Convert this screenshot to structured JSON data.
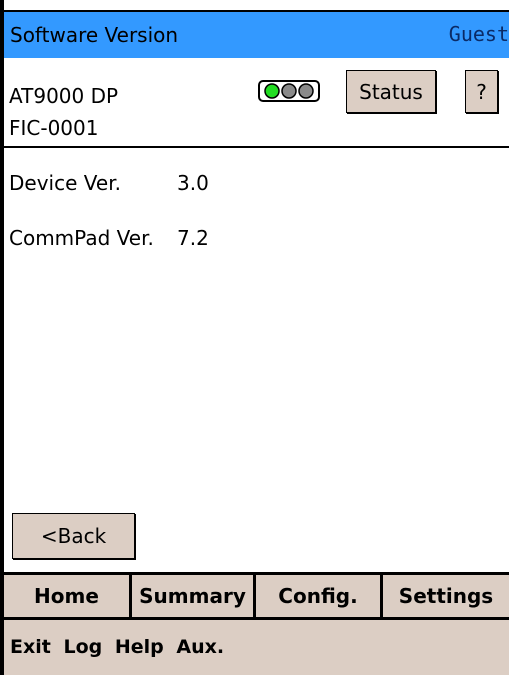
{
  "title_bar": {
    "title": "Software Version",
    "user": "Guest"
  },
  "device": {
    "name": "AT9000 DP",
    "tag": "FIC-0001",
    "status_light": {
      "active": "green",
      "inactive": "gray"
    }
  },
  "header_buttons": {
    "status_label": "Status",
    "help_label": "?"
  },
  "info": [
    {
      "label": "Device Ver.",
      "value": "3.0"
    },
    {
      "label": "CommPad Ver.",
      "value": "7.2"
    }
  ],
  "back_label": "<Back",
  "nav": {
    "tabs": [
      {
        "label": "Home"
      },
      {
        "label": "Summary"
      },
      {
        "label": "Config."
      },
      {
        "label": "Settings"
      }
    ]
  },
  "menu": {
    "items": [
      {
        "label": "Exit"
      },
      {
        "label": "Log"
      },
      {
        "label": "Help"
      },
      {
        "label": "Aux."
      }
    ]
  },
  "colors": {
    "title_bar": "#3399ff",
    "button_bg": "#dccec4",
    "light_green": "#22dd22"
  }
}
